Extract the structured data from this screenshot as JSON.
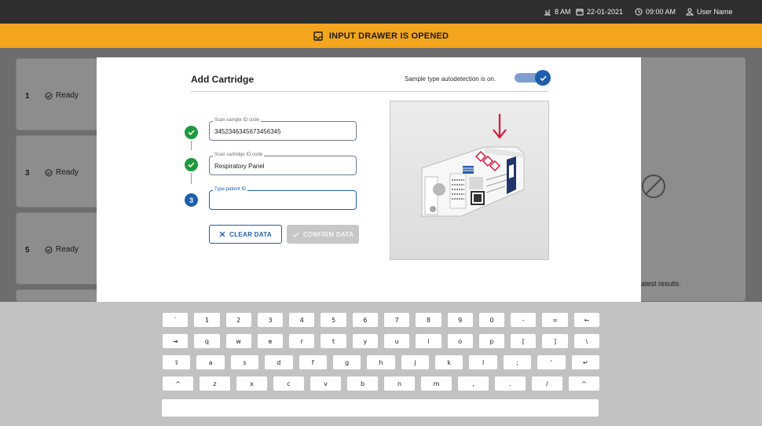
{
  "topbar": {
    "temperature": "8 AM",
    "date": "22-01-2021",
    "time": "09:00 AM",
    "user": "User Name"
  },
  "banner": {
    "text": "INPUT DRAWER IS OPENED"
  },
  "bays": [
    {
      "number": "1",
      "status": "Ready"
    },
    {
      "number": "3",
      "status": "Ready"
    },
    {
      "number": "5",
      "status": "Ready"
    }
  ],
  "right_panel": {
    "text": "atest resutls."
  },
  "modal": {
    "title": "Add Cartridge",
    "autodetect_text": "Sample type autodetection is on.",
    "autodetect_on": true,
    "fields": [
      {
        "label": "Scan sample ID code",
        "value": "3452346345673456345",
        "state": "done"
      },
      {
        "label": "Scan cartridge ID code",
        "value": "Respiratory Panel",
        "state": "done"
      },
      {
        "label": "Type patient ID",
        "value": "",
        "state": "active",
        "step": "3"
      }
    ],
    "clear_label": "CLEAR DATA",
    "confirm_label": "CONFIRM DATA"
  },
  "keyboard": {
    "rows": [
      [
        "`",
        "1",
        "2",
        "3",
        "4",
        "5",
        "6",
        "7",
        "8",
        "9",
        "0",
        "-",
        "=",
        "←"
      ],
      [
        "⇥",
        "q",
        "w",
        "e",
        "r",
        "t",
        "y",
        "u",
        "i",
        "o",
        "p",
        "[",
        "]",
        "\\"
      ],
      [
        "⇪",
        "a",
        "s",
        "d",
        "f",
        "g",
        "h",
        "j",
        "k",
        "l",
        ";",
        "'",
        "↵"
      ],
      [
        "^",
        "z",
        "x",
        "c",
        "v",
        "b",
        "n",
        "m",
        ",",
        ".",
        "/",
        "^"
      ]
    ]
  },
  "colors": {
    "accent": "#1d5fae",
    "success": "#1e9a3c",
    "banner": "#f3a51d",
    "arrow": "#d8173f"
  }
}
